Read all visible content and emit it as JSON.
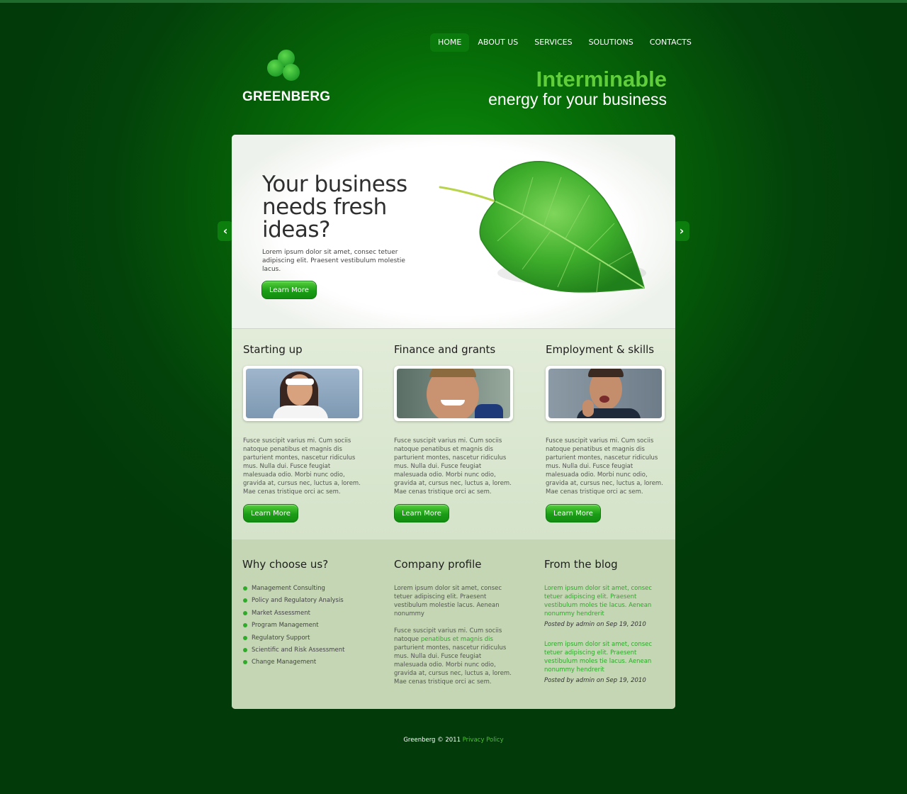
{
  "brand": {
    "name": "GREENBERG"
  },
  "nav": {
    "items": [
      {
        "label": "HOME",
        "active": true
      },
      {
        "label": "ABOUT US",
        "active": false
      },
      {
        "label": "SERVICES",
        "active": false
      },
      {
        "label": "SOLUTIONS",
        "active": false
      },
      {
        "label": "CONTACTS",
        "active": false
      }
    ]
  },
  "tagline": {
    "line1": "Interminable",
    "line2": "energy for your business"
  },
  "hero": {
    "title": "Your business needs fresh ideas?",
    "text": "Lorem ipsum dolor sit amet, consec tetuer adipiscing elit. Praesent vestibulum molestie lacus.",
    "button": "Learn More"
  },
  "services": [
    {
      "title": "Starting up",
      "text": "Fusce suscipit varius mi. Cum sociis natoque penatibus et magnis dis parturient montes, nascetur ridiculus mus. Nulla dui. Fusce feugiat malesuada odio. Morbi nunc odio, gravida at, cursus nec, luctus a, lorem. Mae cenas tristique orci ac sem.",
      "button": "Learn More"
    },
    {
      "title": "Finance and grants",
      "text": "Fusce suscipit varius mi. Cum sociis natoque penatibus et magnis dis parturient montes, nascetur ridiculus mus. Nulla dui. Fusce feugiat malesuada odio. Morbi nunc odio, gravida at, cursus nec, luctus a, lorem. Mae cenas tristique orci ac sem.",
      "button": "Learn More"
    },
    {
      "title": "Employment & skills",
      "text": "Fusce suscipit varius mi. Cum sociis natoque penatibus et magnis dis parturient montes, nascetur ridiculus mus. Nulla dui. Fusce feugiat malesuada odio. Morbi nunc odio, gravida at, cursus nec, luctus a, lorem. Mae cenas tristique orci ac sem.",
      "button": "Learn More"
    }
  ],
  "why": {
    "title": "Why choose us?",
    "items": [
      "Management Consulting",
      "Policy and Regulatory Analysis",
      "Market Assessment",
      "Program Management",
      "Regulatory Support",
      "Scientific and Risk Assessment",
      "Change Management"
    ]
  },
  "profile": {
    "title": "Company profile",
    "para1": "Lorem ipsum dolor sit amet, consec tetuer adipiscing elit. Praesent vestibulum molestie lacus. Aenean nonummy",
    "para2_start": "Fusce suscipit varius mi. Cum sociis natoque ",
    "para2_link": "penatibus et magnis dis",
    "para2_end": " parturient montes, nascetur ridiculus mus. Nulla dui. Fusce feugiat malesuada odio. Morbi nunc odio, gravida at, cursus nec, luctus a, lorem. Mae cenas tristique orci ac sem."
  },
  "blog": {
    "title": "From the blog",
    "posts": [
      {
        "text": "Lorem ipsum dolor sit amet, consec tetuer adipiscing elit. Praesent vestibulum moles tie lacus. Aenean nonummy hendrerit",
        "meta": "Posted by admin on Sep 19, 2010"
      },
      {
        "text": "Lorem ipsum dolor sit amet, consec tetuer adipiscing elit. Praesent vestibulum moles tie lacus. Aenean nonummy hendrerit",
        "meta": "Posted by admin on Sep 19, 2010"
      }
    ]
  },
  "footer": {
    "copyright": "Greenberg © 2011",
    "link": "Privacy Policy"
  },
  "slider": {
    "prev_icon": "chevron-left-icon",
    "next_icon": "chevron-right-icon"
  },
  "colors": {
    "accent": "#2ea82a",
    "tagline_green": "#5fce3a",
    "background": "#066b07"
  }
}
